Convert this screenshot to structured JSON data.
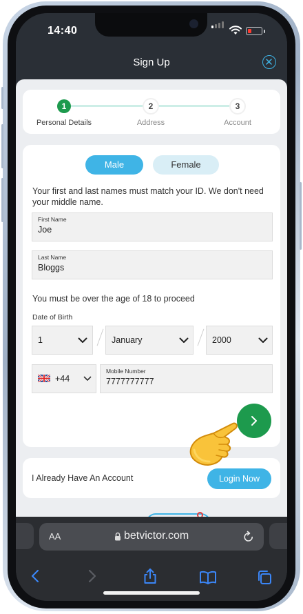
{
  "status_bar": {
    "time": "14:40"
  },
  "header": {
    "title": "Sign Up"
  },
  "stepper": {
    "steps": [
      {
        "number": "1",
        "label": "Personal Details"
      },
      {
        "number": "2",
        "label": "Address"
      },
      {
        "number": "3",
        "label": "Account"
      }
    ]
  },
  "gender": {
    "male": "Male",
    "female": "Female",
    "selected": "Male"
  },
  "name_info": "Your first and last names must match your ID. We don't need your middle name.",
  "first_name": {
    "label": "First Name",
    "value": "Joe"
  },
  "last_name": {
    "label": "Last Name",
    "value": "Bloggs"
  },
  "age_info": "You must be over the age of 18 to proceed",
  "dob": {
    "label": "Date of Birth",
    "day": "1",
    "month": "January",
    "year": "2000"
  },
  "phone": {
    "country_code": "+44",
    "label": "Mobile Number",
    "value": "7777777777"
  },
  "login": {
    "text": "I Already Have An Account",
    "button": "Login Now"
  },
  "browser": {
    "text_size": "AA",
    "url": "betvictor.com"
  },
  "colors": {
    "accent_blue": "#3fb4e6",
    "primary_green": "#1d9a4d",
    "dark_header": "#2a2f36"
  }
}
